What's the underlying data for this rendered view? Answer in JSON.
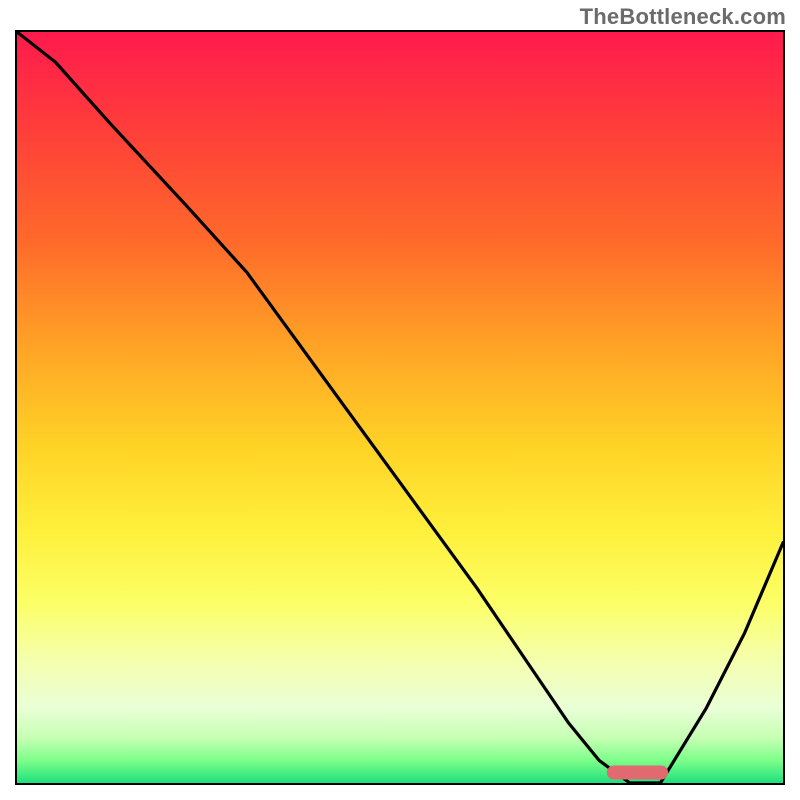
{
  "watermark": "TheBottleneck.com",
  "chart_data": {
    "type": "line",
    "title": "",
    "xlabel": "",
    "ylabel": "",
    "xlim": [
      0,
      100
    ],
    "ylim": [
      0,
      100
    ],
    "grid": false,
    "legend": false,
    "background": "red-to-green vertical gradient",
    "series": [
      {
        "name": "bottleneck-curve",
        "x": [
          0,
          5,
          12,
          22,
          30,
          40,
          50,
          60,
          68,
          72,
          76,
          80,
          84,
          90,
          95,
          100
        ],
        "y": [
          100,
          96,
          88,
          77,
          68,
          54,
          40,
          26,
          14,
          8,
          3,
          0,
          0,
          10,
          20,
          32
        ]
      }
    ],
    "marker": {
      "name": "optimal-range-pill",
      "x_start": 77,
      "x_end": 85,
      "y": 1.4,
      "color": "#e06a6f"
    },
    "gradient_stops": [
      {
        "pos": 0,
        "color": "#ff1a4d"
      },
      {
        "pos": 12,
        "color": "#ff3b3b"
      },
      {
        "pos": 28,
        "color": "#ff6a2a"
      },
      {
        "pos": 42,
        "color": "#ffa426"
      },
      {
        "pos": 55,
        "color": "#ffd226"
      },
      {
        "pos": 66,
        "color": "#ffef3a"
      },
      {
        "pos": 76,
        "color": "#fcff66"
      },
      {
        "pos": 84,
        "color": "#f4ffb0"
      },
      {
        "pos": 90,
        "color": "#e9ffd6"
      },
      {
        "pos": 94,
        "color": "#c6ffb3"
      },
      {
        "pos": 97,
        "color": "#7dff8a"
      },
      {
        "pos": 100,
        "color": "#1ee07d"
      }
    ]
  }
}
